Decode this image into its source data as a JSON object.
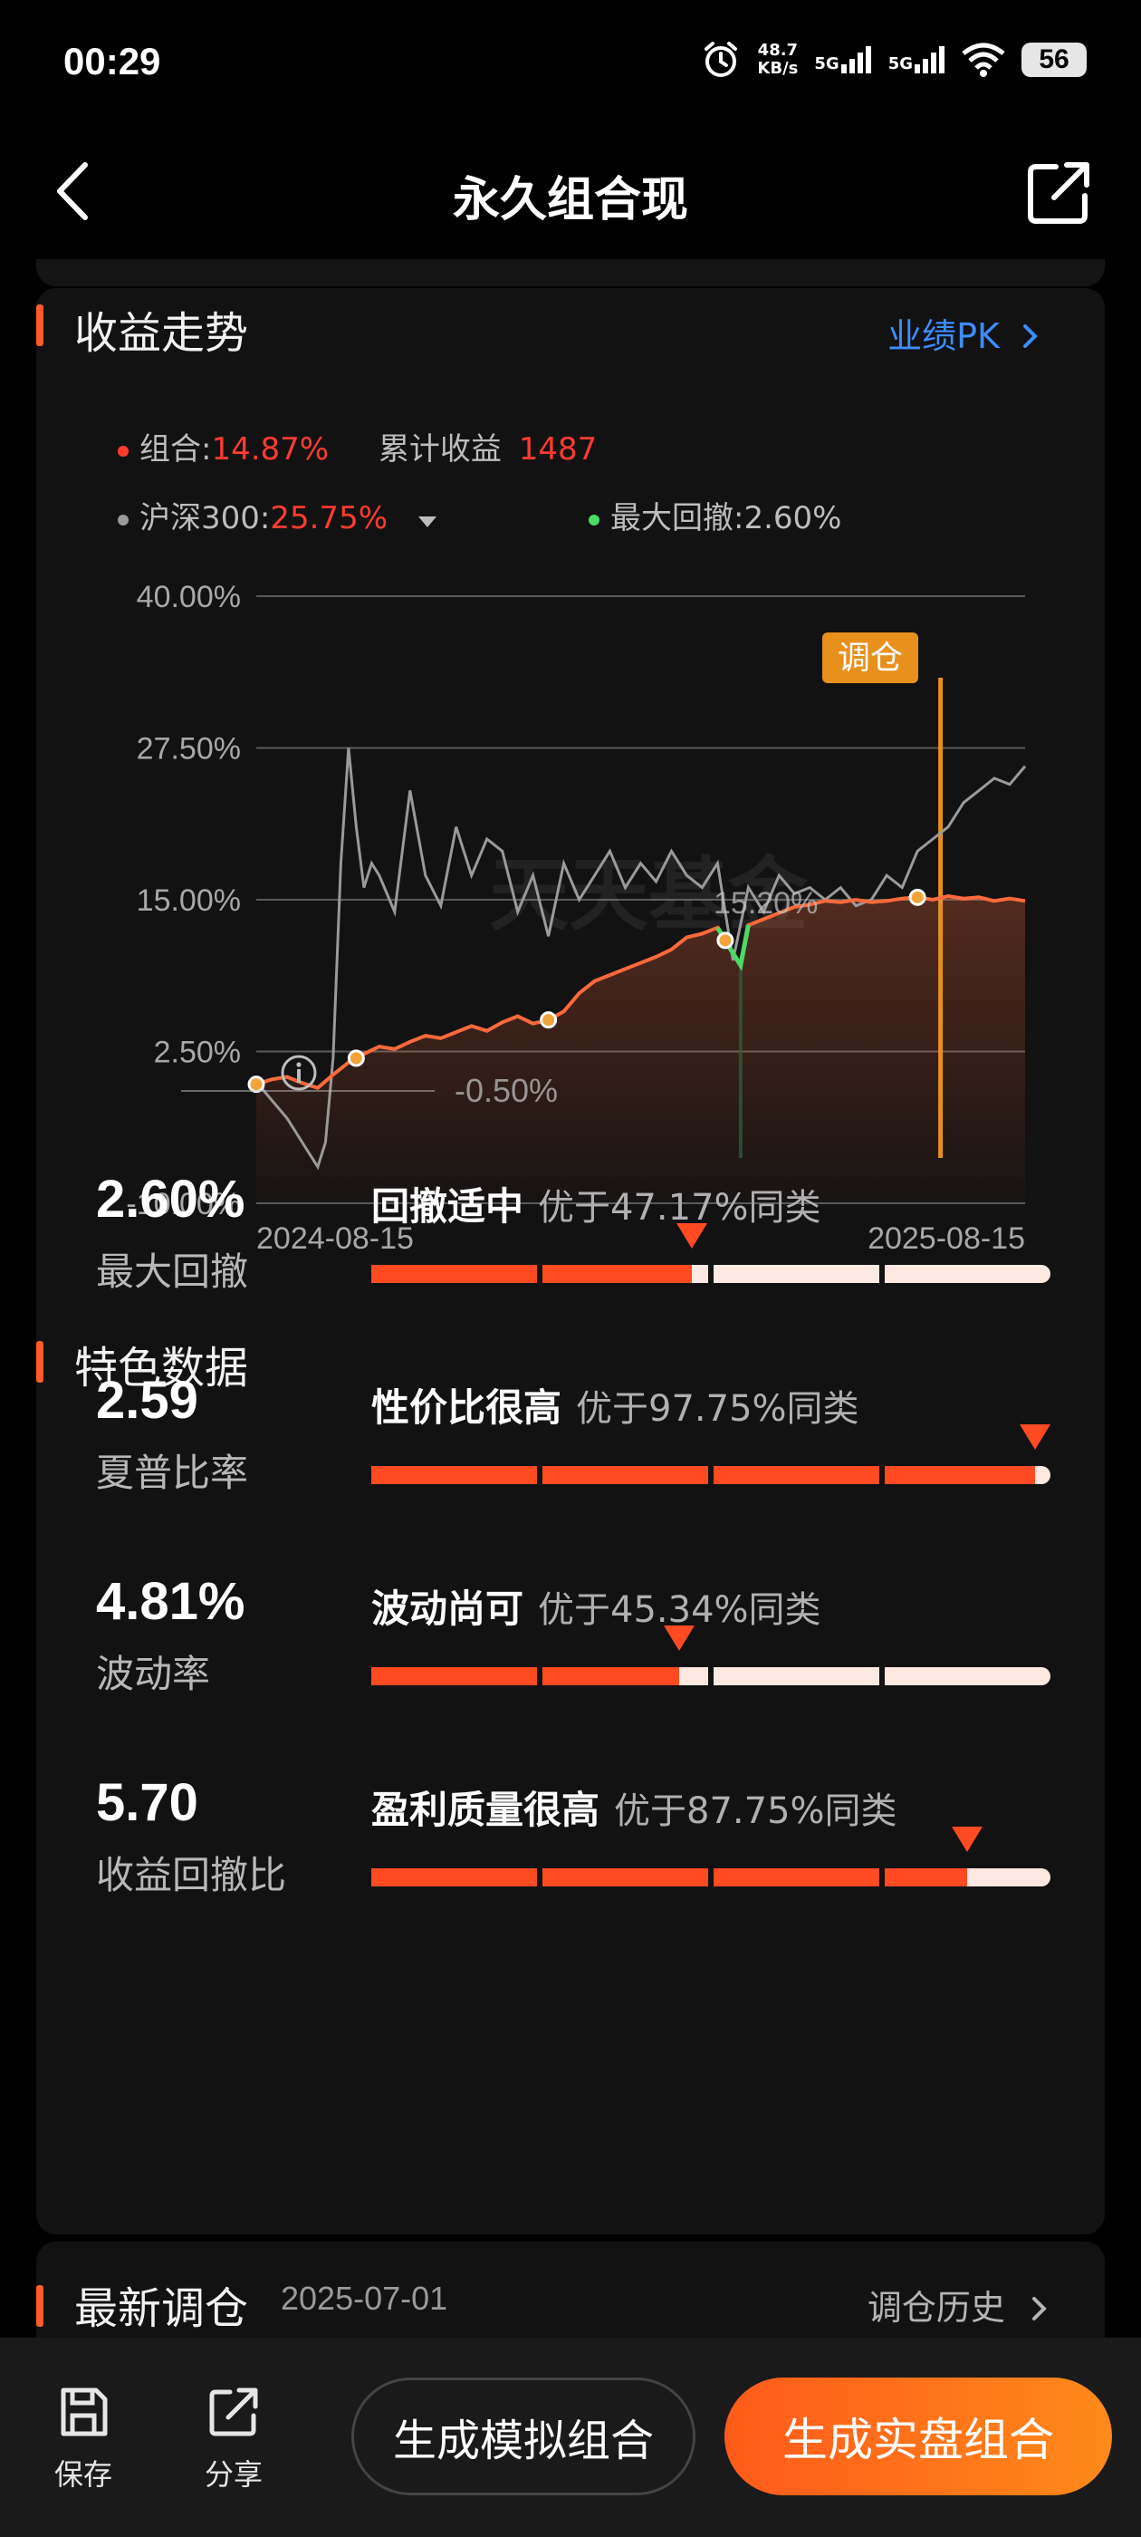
{
  "status": {
    "time": "00:29",
    "net_speed_value": "48.7",
    "net_speed_unit": "KB/s",
    "sig1": "5G",
    "sig2": "5G",
    "battery": "56"
  },
  "nav": {
    "title": "永久组合现"
  },
  "trend": {
    "title": "收益走势",
    "pk_link": "业绩PK",
    "legend": {
      "portfolio_label": "组合:",
      "portfolio_value": "14.87%",
      "cumulative_label": "累计收益",
      "cumulative_value": "1487",
      "benchmark_label": "沪深300:",
      "benchmark_value": "25.75%",
      "drawdown_label": "最大回撤:",
      "drawdown_value": "2.60%"
    },
    "rebalance_tag": "调仓",
    "annotation_mid": "15.20%",
    "annotation_low": "-0.50%",
    "watermark": "天天基金"
  },
  "chart_data": {
    "type": "line",
    "ylim": [
      -10,
      40
    ],
    "yticks": [
      "40.00%",
      "27.50%",
      "15.00%",
      "2.50%",
      "-10.00%"
    ],
    "xticks": [
      "2024-08-15",
      "2025-08-15"
    ],
    "colors": {
      "portfolio": "#ff6a3d",
      "benchmark": "#9a9a9a",
      "drawdown": "#4cd964",
      "rebalance": "#e8901c"
    },
    "series": [
      {
        "name": "组合",
        "x": [
          0,
          2,
          4,
          6,
          8,
          10,
          12,
          14,
          16,
          18,
          20,
          22,
          24,
          26,
          28,
          30,
          32,
          34,
          36,
          38,
          40,
          42,
          44,
          46,
          48,
          50,
          52,
          54,
          56,
          58,
          60,
          62,
          63,
          64,
          66,
          68,
          70,
          72,
          74,
          76,
          78,
          80,
          82,
          84,
          86,
          88,
          90,
          92,
          94,
          96,
          98,
          100
        ],
        "values": [
          -0.2,
          0.2,
          0.4,
          -0.1,
          -0.5,
          0.6,
          1.6,
          2.3,
          2.9,
          2.7,
          3.3,
          3.8,
          3.6,
          4.1,
          4.6,
          4.2,
          4.9,
          5.4,
          4.8,
          5.1,
          5.8,
          7.3,
          8.3,
          8.8,
          9.3,
          9.8,
          10.3,
          10.9,
          11.9,
          12.2,
          12.7,
          10.6,
          9.6,
          12.9,
          13.4,
          13.9,
          14.4,
          14.6,
          14.9,
          14.8,
          15.0,
          14.8,
          14.9,
          15.1,
          15.2,
          15.0,
          15.3,
          15.1,
          15.2,
          14.9,
          15.1,
          14.9
        ]
      },
      {
        "name": "沪深300",
        "x": [
          0,
          2,
          4,
          6,
          8,
          9,
          10,
          11,
          12,
          13,
          14,
          15,
          16,
          18,
          20,
          22,
          24,
          26,
          28,
          30,
          32,
          34,
          36,
          38,
          40,
          42,
          44,
          46,
          48,
          50,
          52,
          54,
          56,
          58,
          60,
          62,
          63,
          64,
          66,
          68,
          70,
          72,
          74,
          76,
          78,
          80,
          82,
          84,
          86,
          88,
          90,
          92,
          94,
          96,
          98,
          100
        ],
        "values": [
          0,
          -1.5,
          -3,
          -5,
          -7,
          -5,
          2,
          18,
          27.5,
          21,
          16,
          18,
          17,
          14,
          24,
          17,
          14.5,
          21,
          17,
          20,
          19,
          14,
          17,
          12,
          18,
          15,
          17,
          19,
          16,
          18,
          16.5,
          19,
          17,
          16,
          18,
          10,
          13,
          16,
          14,
          17,
          15.5,
          16,
          15,
          16,
          14.5,
          15,
          17,
          16,
          19,
          20,
          21,
          23,
          24,
          25,
          24.5,
          26
        ]
      }
    ],
    "rebalance_x": [
      89
    ],
    "point_markers_x": [
      0,
      13,
      38,
      61,
      86
    ]
  },
  "features": {
    "title": "特色数据",
    "metrics": [
      {
        "value": "2.60%",
        "name": "最大回撤",
        "headline": "回撤适中",
        "sub": "优于47.17%同类",
        "percentile": 47.17
      },
      {
        "value": "2.59",
        "name": "夏普比率",
        "headline": "性价比很高",
        "sub": "优于97.75%同类",
        "percentile": 97.75
      },
      {
        "value": "4.81%",
        "name": "波动率",
        "headline": "波动尚可",
        "sub": "优于45.34%同类",
        "percentile": 45.34
      },
      {
        "value": "5.70",
        "name": "收益回撤比",
        "headline": "盈利质量很高",
        "sub": "优于87.75%同类",
        "percentile": 87.75
      }
    ]
  },
  "latest": {
    "title": "最新调仓",
    "date": "2025-07-01",
    "history_link": "调仓历史"
  },
  "bottom": {
    "save_label": "保存",
    "share_label": "分享",
    "sim_button": "生成模拟组合",
    "real_button": "生成实盘组合"
  }
}
